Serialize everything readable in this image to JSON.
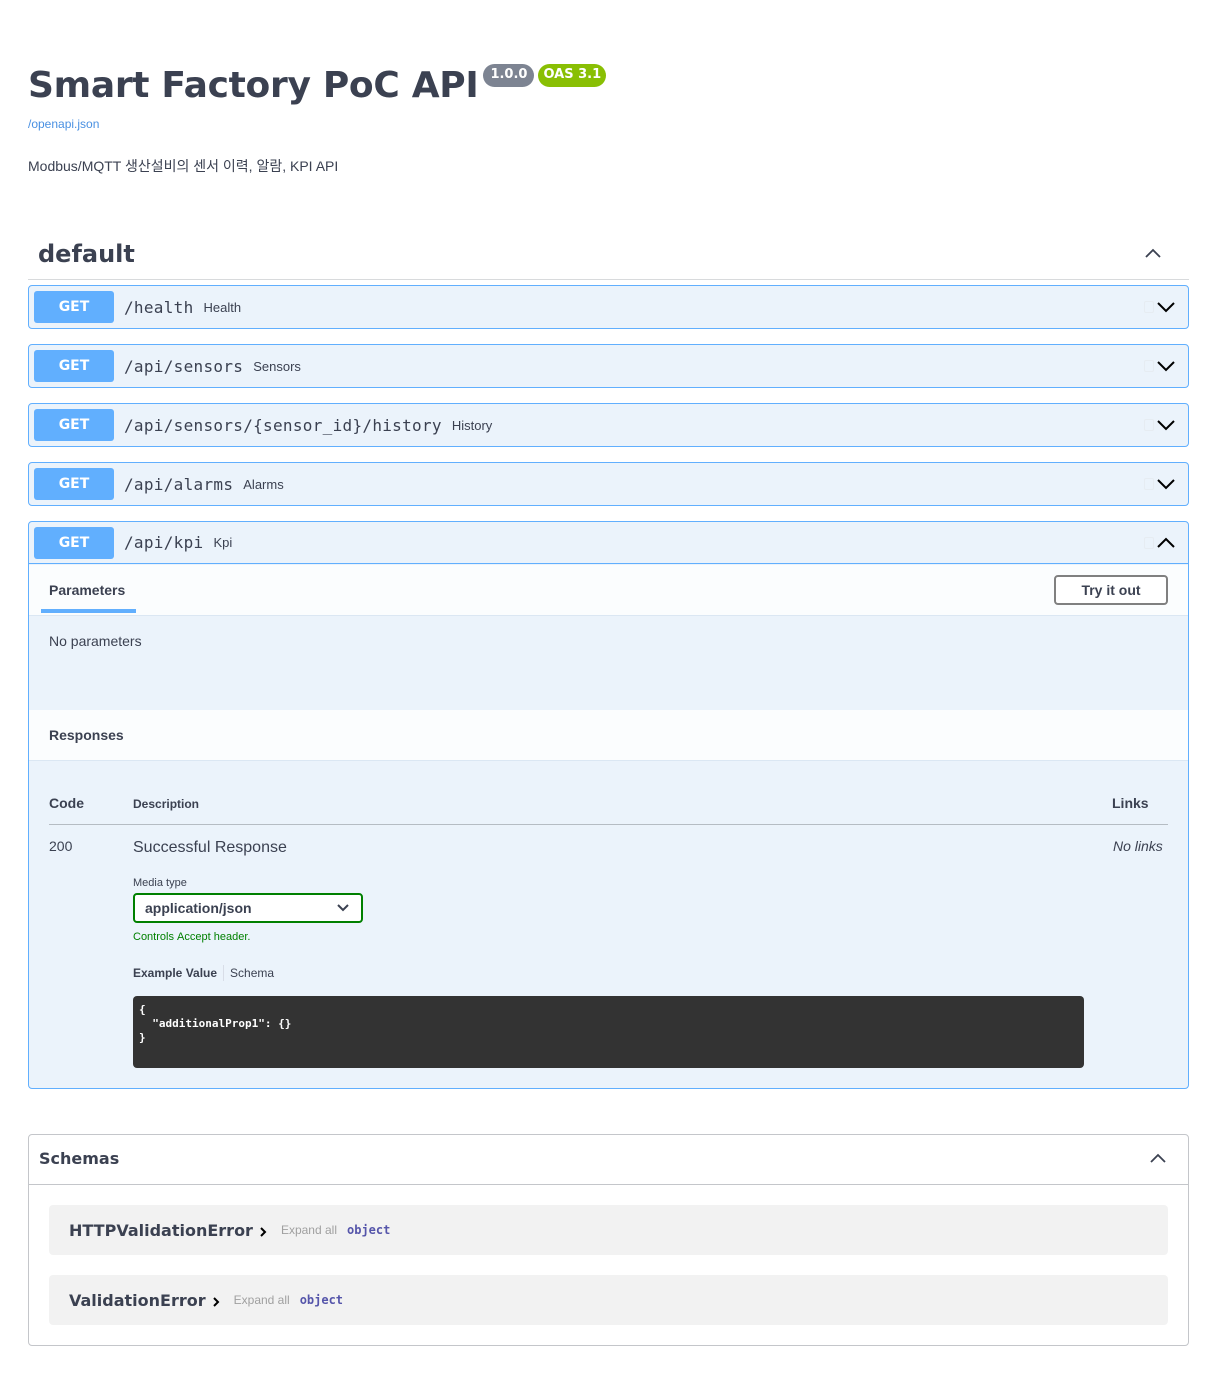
{
  "info": {
    "title": "Smart Factory PoC API",
    "version": "1.0.0",
    "oas": "OAS 3.1",
    "spec_link": "/openapi.json",
    "description": "Modbus/MQTT 생산설비의 센서 이력, 알람, KPI API"
  },
  "tag": {
    "name": "default"
  },
  "operations": [
    {
      "method": "GET",
      "path": "/health",
      "summary": "Health"
    },
    {
      "method": "GET",
      "path": "/api/sensors",
      "summary": "Sensors"
    },
    {
      "method": "GET",
      "path": "/api/sensors/{sensor_id}/history",
      "summary": "History"
    },
    {
      "method": "GET",
      "path": "/api/alarms",
      "summary": "Alarms"
    },
    {
      "method": "GET",
      "path": "/api/kpi",
      "summary": "Kpi"
    }
  ],
  "expanded": {
    "params_tab": "Parameters",
    "try_button": "Try it out",
    "no_params": "No parameters",
    "responses_title": "Responses",
    "col_code": "Code",
    "col_description": "Description",
    "col_links": "Links",
    "response": {
      "code": "200",
      "description": "Successful Response",
      "links": "No links",
      "media_type_label": "Media type",
      "media_type_value": "application/json",
      "accept_note_prefix": "Controls ",
      "accept_note_code": "Accept",
      "accept_note_suffix": " header.",
      "example_value_tab": "Example Value",
      "schema_tab": "Schema",
      "example_json": "{\n  \"additionalProp1\": {}\n}"
    }
  },
  "schemas": {
    "title": "Schemas",
    "models": [
      {
        "name": "HTTPValidationError",
        "expand": "Expand all",
        "type": "object"
      },
      {
        "name": "ValidationError",
        "expand": "Expand all",
        "type": "object"
      }
    ]
  },
  "colors": {
    "get_accent": "#61affe",
    "get_bg": "#ebf3fb",
    "version_badge": "#7d8492",
    "oas_badge": "#89bf04",
    "select_border": "#008000"
  }
}
